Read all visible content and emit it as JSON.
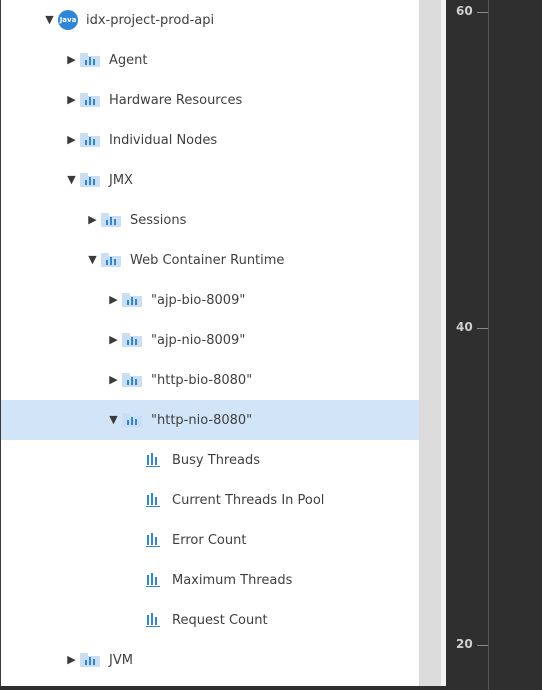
{
  "tree": {
    "root": "idx-project-prod-api",
    "root_icon": "java-icon",
    "items": [
      {
        "label": "Agent",
        "state": "collapsed"
      },
      {
        "label": "Hardware Resources",
        "state": "collapsed"
      },
      {
        "label": "Individual Nodes",
        "state": "collapsed"
      },
      {
        "label": "JMX",
        "state": "expanded"
      },
      {
        "label": "Sessions",
        "state": "collapsed"
      },
      {
        "label": "Web Container Runtime",
        "state": "expanded"
      },
      {
        "label": "\"ajp-bio-8009\"",
        "state": "collapsed"
      },
      {
        "label": "\"ajp-nio-8009\"",
        "state": "collapsed"
      },
      {
        "label": "\"http-bio-8080\"",
        "state": "collapsed"
      },
      {
        "label": "\"http-nio-8080\"",
        "state": "expanded",
        "selected": true
      },
      {
        "label": "Busy Threads",
        "type": "metric"
      },
      {
        "label": "Current Threads In Pool",
        "type": "metric"
      },
      {
        "label": "Error Count",
        "type": "metric"
      },
      {
        "label": "Maximum Threads",
        "type": "metric"
      },
      {
        "label": "Request Count",
        "type": "metric"
      },
      {
        "label": "JVM",
        "state": "collapsed"
      }
    ]
  },
  "chart_axis": {
    "ticks": [
      "60",
      "40",
      "20"
    ]
  },
  "colors": {
    "accent": "#2f86d6",
    "selected_row": "#d2e5f8",
    "folder": "#c9def3",
    "chart_bg": "#2f2f2f"
  }
}
